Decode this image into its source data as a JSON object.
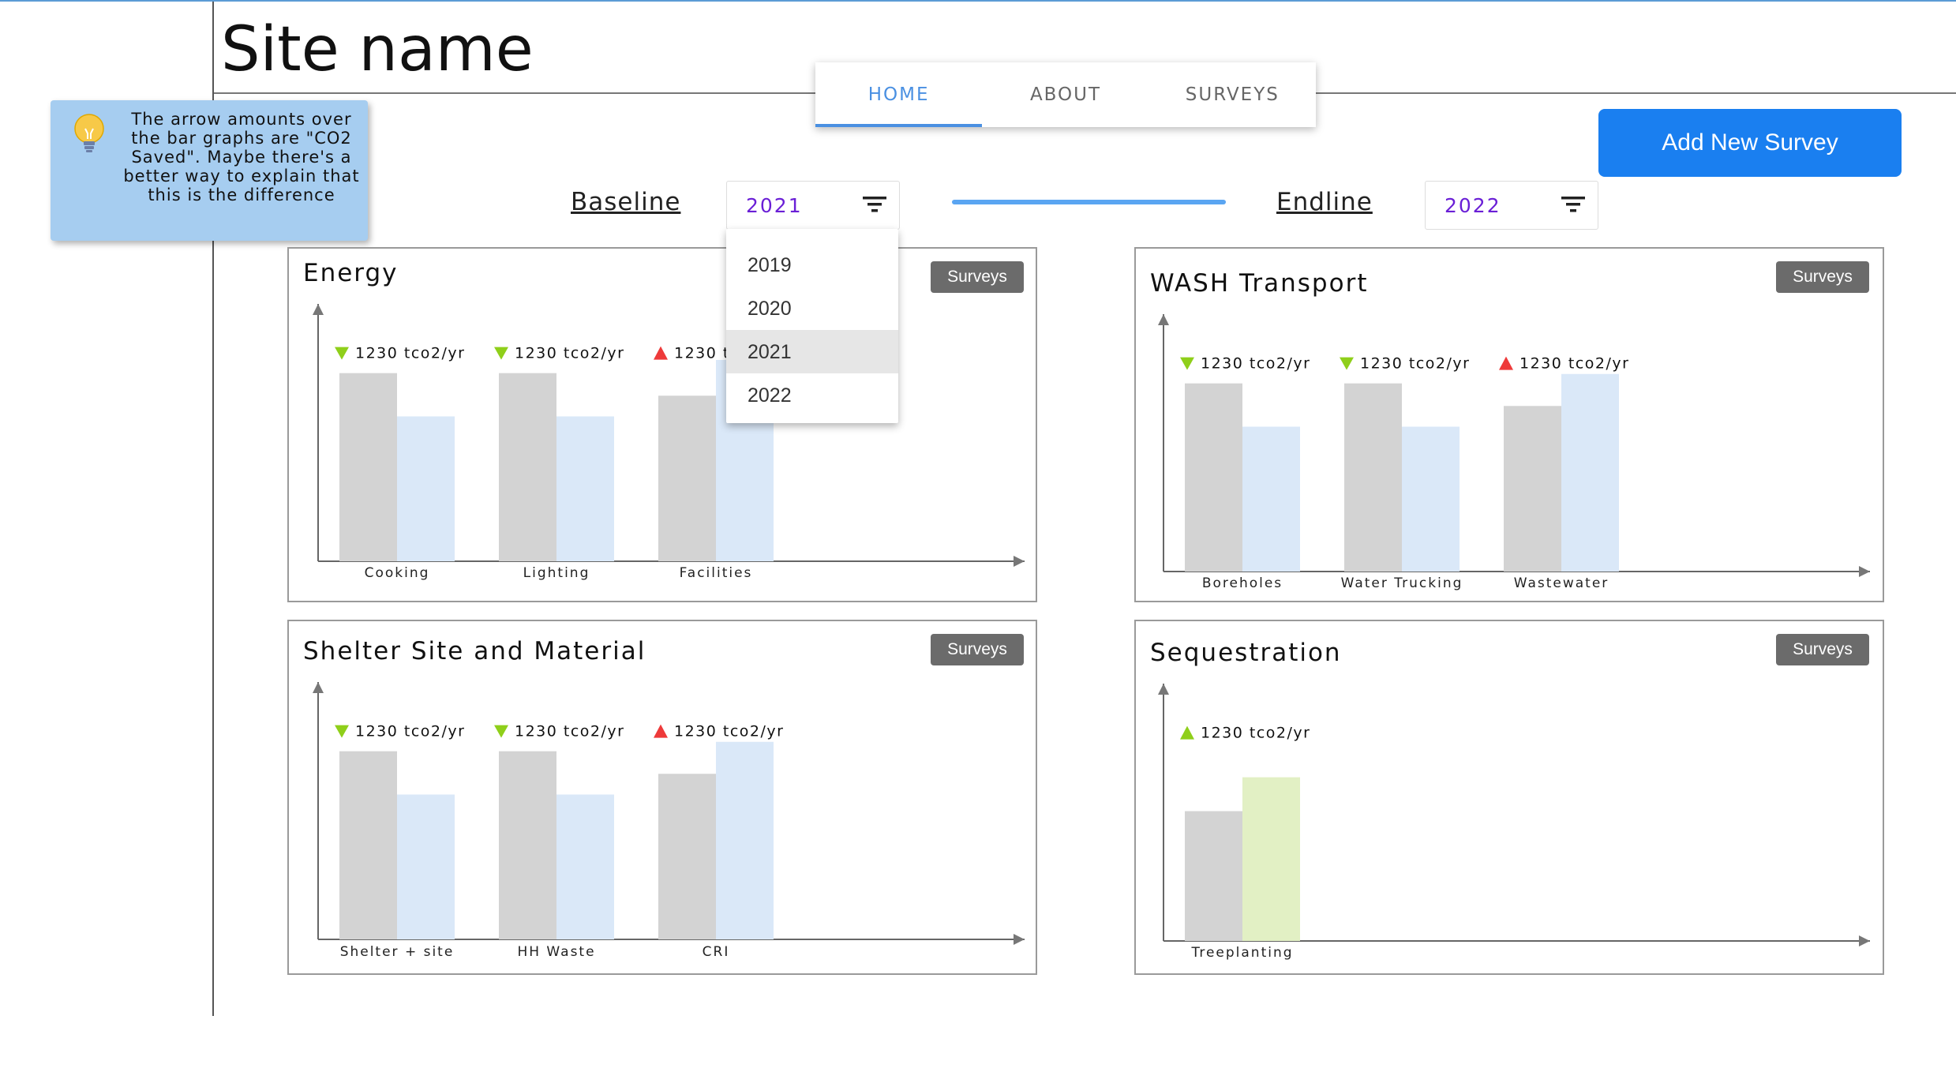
{
  "site_title": "Site name",
  "tabs": [
    {
      "label": "HOME",
      "active": true
    },
    {
      "label": "ABOUT",
      "active": false
    },
    {
      "label": "SURVEYS",
      "active": false
    }
  ],
  "note": {
    "text": "The arrow amounts over the bar graphs are \"CO2 Saved\". Maybe there's a better way to explain that this is the difference",
    "icon": "lightbulb-icon"
  },
  "add_button": "Add New Survey",
  "baseline": {
    "label": "Baseline",
    "value": "2021"
  },
  "endline": {
    "label": "Endline",
    "value": "2022"
  },
  "dropdown": {
    "options": [
      "2019",
      "2020",
      "2021",
      "2022"
    ],
    "selected": "2021"
  },
  "colors": {
    "baseline_bar": "#d3d3d3",
    "endline_bar": "#dae8f8",
    "sequestration_bar": "#e2f0c4",
    "down_arrow": "#8fcf1a",
    "up_arrow_red": "#ee3a3a",
    "up_arrow_green": "#8fcf1a",
    "accent": "#1a7ff0",
    "tab_active": "#4a90e2",
    "select_value": "#6a1fd6"
  },
  "panels": [
    {
      "title": "Energy",
      "surveys_label": "Surveys"
    },
    {
      "title": "WASH Transport",
      "surveys_label": "Surveys"
    },
    {
      "title": "Shelter Site and Material",
      "surveys_label": "Surveys"
    },
    {
      "title": "Sequestration",
      "surveys_label": "Surveys"
    }
  ],
  "chart_data": [
    {
      "type": "bar",
      "title": "Energy",
      "categories": [
        "Cooking",
        "Lighting",
        "Facilities"
      ],
      "series": [
        {
          "values": [
            100,
            100,
            88
          ]
        },
        {
          "values": [
            77,
            77,
            107
          ]
        }
      ],
      "annotations": [
        {
          "text": "1230 tco2/yr",
          "direction": "down"
        },
        {
          "text": "1230 tco2/yr",
          "direction": "down"
        },
        {
          "text": "1230 tco2/yr",
          "direction": "up"
        }
      ],
      "ylim": [
        0,
        120
      ]
    },
    {
      "type": "bar",
      "title": "WASH Transport",
      "categories": [
        "Boreholes",
        "Water Trucking",
        "Wastewater"
      ],
      "series": [
        {
          "values": [
            100,
            100,
            88
          ]
        },
        {
          "values": [
            77,
            77,
            105
          ]
        }
      ],
      "annotations": [
        {
          "text": "1230 tco2/yr",
          "direction": "down"
        },
        {
          "text": "1230 tco2/yr",
          "direction": "down"
        },
        {
          "text": "1230 tco2/yr",
          "direction": "up"
        }
      ],
      "ylim": [
        0,
        120
      ]
    },
    {
      "type": "bar",
      "title": "Shelter Site and Material",
      "categories": [
        "Shelter + site",
        "HH Waste",
        "CRI"
      ],
      "series": [
        {
          "values": [
            100,
            100,
            88
          ]
        },
        {
          "values": [
            77,
            77,
            105
          ]
        }
      ],
      "annotations": [
        {
          "text": "1230 tco2/yr",
          "direction": "down"
        },
        {
          "text": "1230 tco2/yr",
          "direction": "down"
        },
        {
          "text": "1230 tco2/yr",
          "direction": "up"
        }
      ],
      "ylim": [
        0,
        120
      ]
    },
    {
      "type": "bar",
      "title": "Sequestration",
      "categories": [
        "Treeplanting"
      ],
      "series": [
        {
          "values": [
            69
          ]
        },
        {
          "values": [
            87
          ]
        }
      ],
      "annotations": [
        {
          "text": "1230 tco2/yr",
          "direction": "up-green"
        }
      ],
      "ylim": [
        0,
        120
      ]
    }
  ]
}
